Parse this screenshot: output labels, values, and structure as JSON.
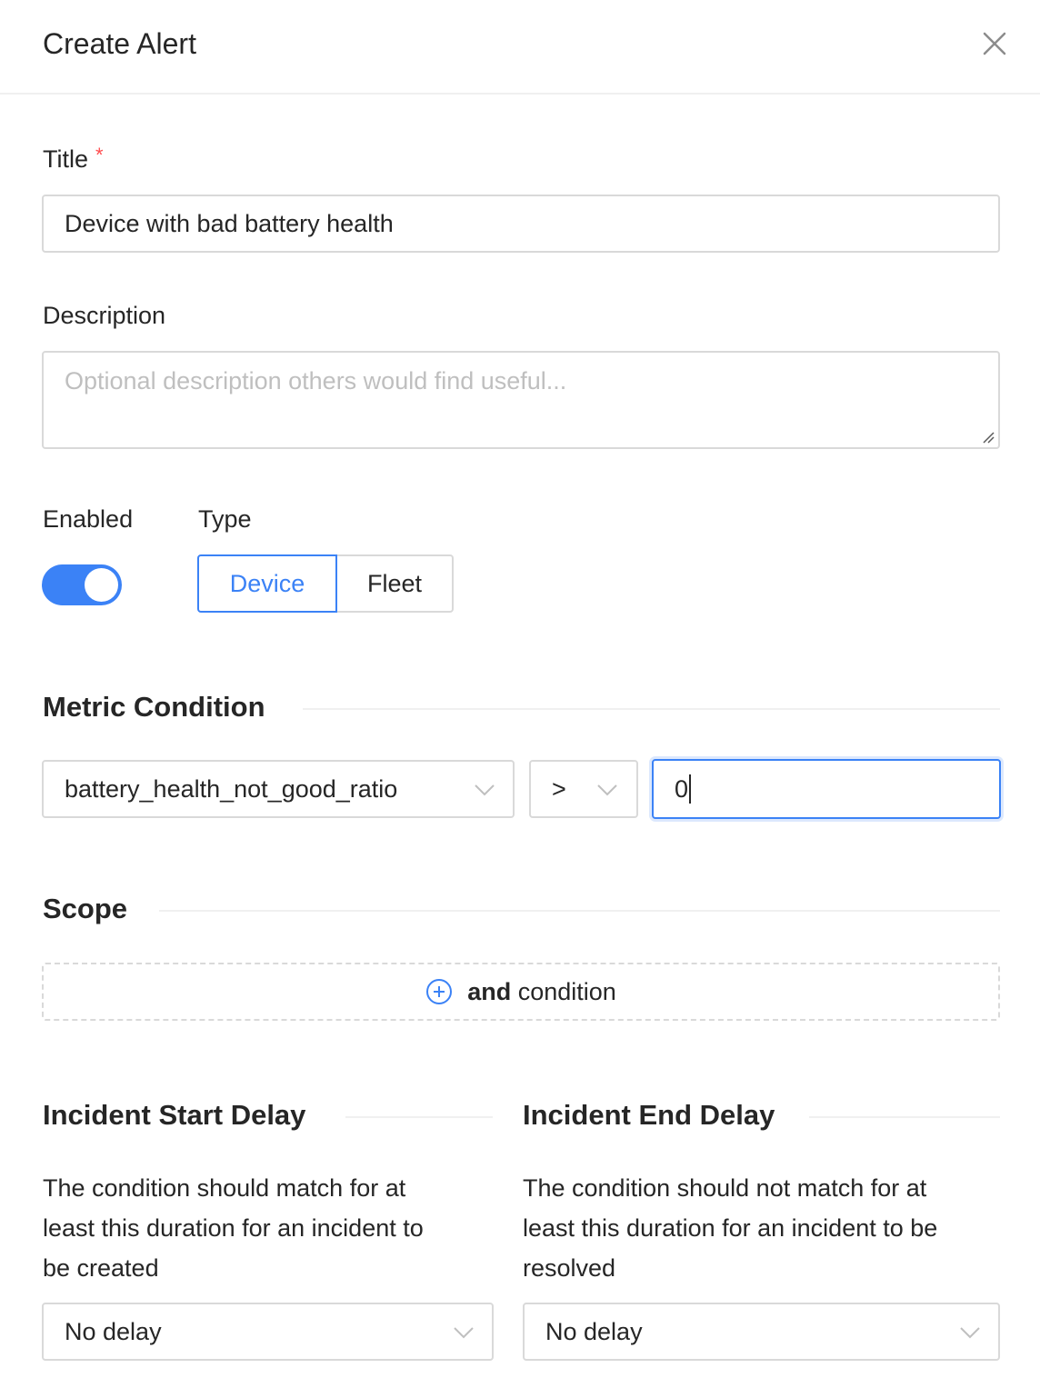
{
  "header": {
    "title": "Create Alert"
  },
  "title_field": {
    "label": "Title",
    "required_mark": "*",
    "value": "Device with bad battery health"
  },
  "description_field": {
    "label": "Description",
    "placeholder": "Optional description others would find useful..."
  },
  "enabled": {
    "label": "Enabled",
    "on": true,
    "color": "#3b82f6"
  },
  "type": {
    "label": "Type",
    "options": [
      "Device",
      "Fleet"
    ],
    "selected": "Device"
  },
  "metric_condition": {
    "title": "Metric Condition",
    "metric": "battery_health_not_good_ratio",
    "operator": ">",
    "value": "0"
  },
  "scope": {
    "title": "Scope",
    "button_bold": "and",
    "button_rest": " condition"
  },
  "start_delay": {
    "title": "Incident Start Delay",
    "help_lines": [
      "The condition should match for at",
      "least this duration for an incident to",
      "be created"
    ],
    "value": "No delay"
  },
  "end_delay": {
    "title": "Incident End Delay",
    "help_lines": [
      "The condition should not match for at",
      "least this duration for an incident to be",
      "resolved"
    ],
    "value": "No delay"
  },
  "accent_color": "#3b82f6"
}
